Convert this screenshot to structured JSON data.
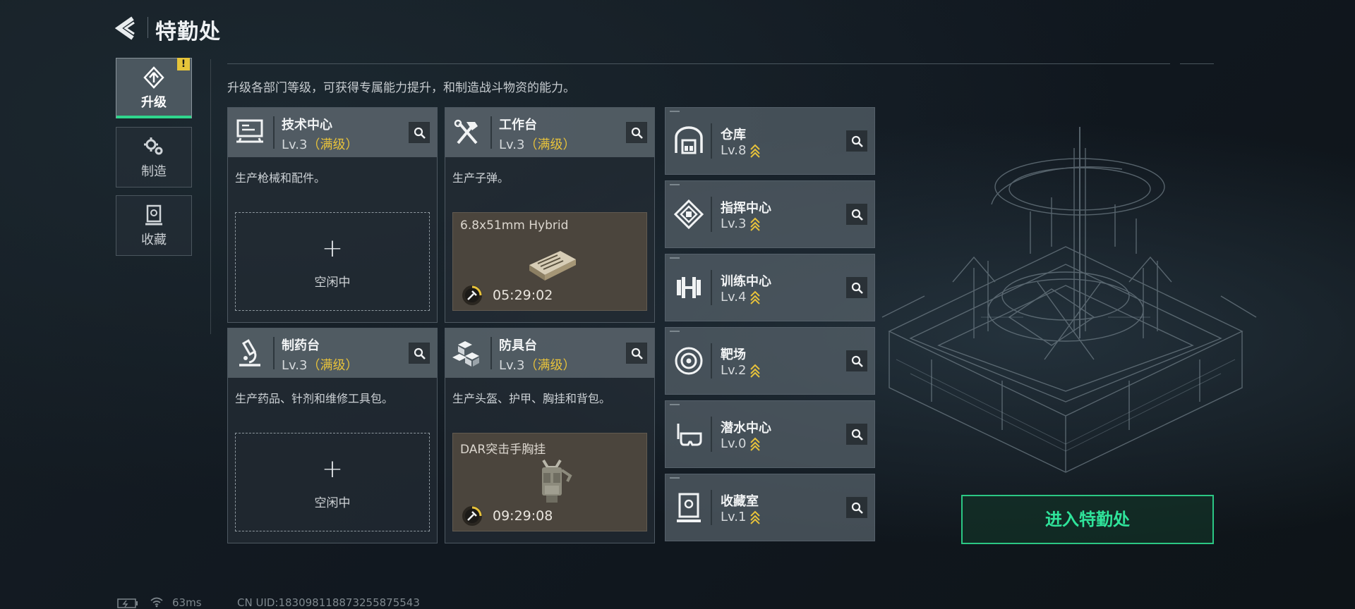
{
  "header": {
    "title": "特勤处"
  },
  "nav": [
    {
      "label": "升级",
      "icon": "upgrade-icon",
      "active": true,
      "badge": "!"
    },
    {
      "label": "制造",
      "icon": "gears-icon",
      "active": false
    },
    {
      "label": "收藏",
      "icon": "collection-icon",
      "active": false
    }
  ],
  "description": "升级各部门等级，可获得专属能力提升，和制造战斗物资的能力。",
  "cards": [
    {
      "name": "技术中心",
      "level": "Lv.3",
      "max_tag": "（满级）",
      "icon": "computer-icon",
      "desc": "生产枪械和配件。",
      "slot_label": "空闲中",
      "plus": "+"
    },
    {
      "name": "工作台",
      "level": "Lv.3",
      "max_tag": "（满级）",
      "icon": "tools-icon",
      "desc": "生产子弹。",
      "prod_name": "6.8x51mm Hybrid",
      "prod_time": "05:29:02"
    },
    {
      "name": "制药台",
      "level": "Lv.3",
      "max_tag": "（满级）",
      "icon": "microscope-icon",
      "desc": "生产药品、针剂和维修工具包。",
      "slot_label": "空闲中",
      "plus": "+"
    },
    {
      "name": "防具台",
      "level": "Lv.3",
      "max_tag": "（满级）",
      "icon": "armor-blocks-icon",
      "desc": "生产头盔、护甲、胸挂和背包。",
      "prod_name": "DAR突击手胸挂",
      "prod_time": "09:29:08"
    }
  ],
  "facilities": [
    {
      "name": "仓库",
      "level": "Lv.8",
      "icon": "warehouse-icon"
    },
    {
      "name": "指挥中心",
      "level": "Lv.3",
      "icon": "command-chip-icon"
    },
    {
      "name": "训练中心",
      "level": "Lv.4",
      "icon": "dumbbell-icon"
    },
    {
      "name": "靶场",
      "level": "Lv.2",
      "icon": "target-icon"
    },
    {
      "name": "潜水中心",
      "level": "Lv.0",
      "icon": "diving-mask-icon"
    },
    {
      "name": "收藏室",
      "level": "Lv.1",
      "icon": "display-case-icon"
    }
  ],
  "enter_button": "进入特勤处",
  "status": {
    "ping": "63ms",
    "uid": "CN UID:18309811887325587554​3"
  },
  "colors": {
    "accent_green": "#2fe39a",
    "max_level_gold": "#e7c23b",
    "alert_yellow": "#e6c43a"
  }
}
